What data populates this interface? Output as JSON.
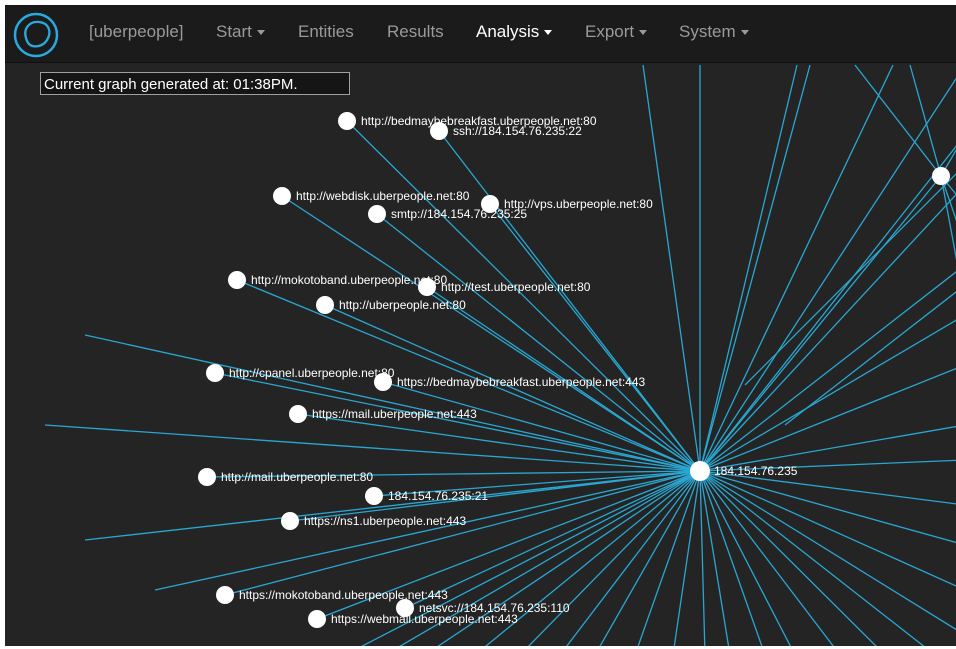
{
  "navbar": {
    "logo": "spiderfoot-logo-icon",
    "items": [
      {
        "label": "[uberpeople]",
        "dropdown": false,
        "active": false
      },
      {
        "label": "Start",
        "dropdown": true,
        "active": false
      },
      {
        "label": "Entities",
        "dropdown": false,
        "active": false
      },
      {
        "label": "Results",
        "dropdown": false,
        "active": false
      },
      {
        "label": "Analysis",
        "dropdown": true,
        "active": true
      },
      {
        "label": "Export",
        "dropdown": true,
        "active": false
      },
      {
        "label": "System",
        "dropdown": true,
        "active": false
      }
    ]
  },
  "timestamp": "Current graph generated at: 01:38PM.",
  "colors": {
    "background": "#242424",
    "navbar": "#1b1b1b",
    "edge": "#29a7d2",
    "node": "#ffffff",
    "logo": "#2aa9e0"
  },
  "graph": {
    "hub": "184.154.76.235",
    "nodes": [
      "http://bedmaybebreakfast.uberpeople.net:80",
      "ssh://184.154.76.235:22",
      "http://webdisk.uberpeople.net:80",
      "http://vps.uberpeople.net:80",
      "smtp://184.154.76.235:25",
      "http://mokotoband.uberpeople.net:80",
      "http://test.uberpeople.net:80",
      "http://uberpeople.net:80",
      "http://cpanel.uberpeople.net:80",
      "https://bedmaybebreakfast.uberpeople.net:443",
      "https://mail.uberpeople.net:443",
      "http://mail.uberpeople.net:80",
      "184.154.76.235:21",
      "https://ns1.uberpeople.net:443",
      "https://mokotoband.uberpeople.net:443",
      "netsvc://184.154.76.235:110",
      "https://webmail.uberpeople.net:443",
      ""
    ]
  }
}
